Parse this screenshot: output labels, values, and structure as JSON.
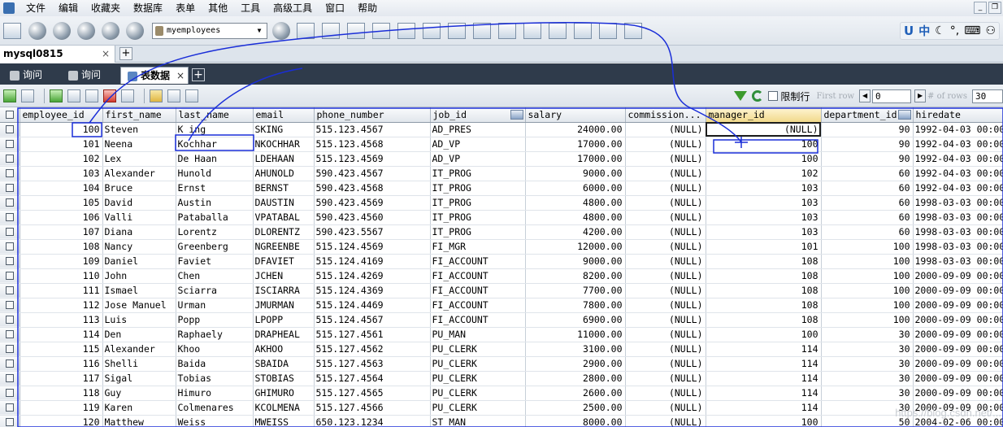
{
  "menu": [
    "文件",
    "编辑",
    "收藏夹",
    "数据库",
    "表单",
    "其他",
    "工具",
    "高级工具",
    "窗口",
    "帮助"
  ],
  "toolbar": {
    "database_select": "myemployees"
  },
  "ime": {
    "logo": "U",
    "lang": "中",
    "punct": "°,"
  },
  "connection_tab": {
    "label": "mysql0815",
    "close": "×",
    "add": "+"
  },
  "query_tabs": [
    {
      "label": "询问",
      "active": false
    },
    {
      "label": "询问",
      "active": false
    },
    {
      "label": "表数据",
      "active": true,
      "close": "×"
    }
  ],
  "query_add": "+",
  "grid_toolbar": {
    "limit_label": "限制行",
    "first_row_placeholder": "First row",
    "first_row_value": "0",
    "num_rows_placeholder": "# of rows",
    "num_rows_value": "30"
  },
  "columns": [
    "employee_id",
    "first_name",
    "last_name",
    "email",
    "phone_number",
    "job_id",
    "salary",
    "commission...",
    "manager_id",
    "department_id",
    "hiredate"
  ],
  "rows": [
    [
      "100",
      "Steven",
      "K_ing",
      "SKING",
      "515.123.4567",
      "AD_PRES",
      "24000.00",
      "(NULL)",
      "(NULL)",
      "90",
      "1992-04-03 00:00"
    ],
    [
      "101",
      "Neena",
      "Kochhar",
      "NKOCHHAR",
      "515.123.4568",
      "AD_VP",
      "17000.00",
      "(NULL)",
      "100",
      "90",
      "1992-04-03 00:00"
    ],
    [
      "102",
      "Lex",
      "De Haan",
      "LDEHAAN",
      "515.123.4569",
      "AD_VP",
      "17000.00",
      "(NULL)",
      "100",
      "90",
      "1992-04-03 00:00"
    ],
    [
      "103",
      "Alexander",
      "Hunold",
      "AHUNOLD",
      "590.423.4567",
      "IT_PROG",
      "9000.00",
      "(NULL)",
      "102",
      "60",
      "1992-04-03 00:00"
    ],
    [
      "104",
      "Bruce",
      "Ernst",
      "BERNST",
      "590.423.4568",
      "IT_PROG",
      "6000.00",
      "(NULL)",
      "103",
      "60",
      "1992-04-03 00:00"
    ],
    [
      "105",
      "David",
      "Austin",
      "DAUSTIN",
      "590.423.4569",
      "IT_PROG",
      "4800.00",
      "(NULL)",
      "103",
      "60",
      "1998-03-03 00:00"
    ],
    [
      "106",
      "Valli",
      "Pataballa",
      "VPATABAL",
      "590.423.4560",
      "IT_PROG",
      "4800.00",
      "(NULL)",
      "103",
      "60",
      "1998-03-03 00:00"
    ],
    [
      "107",
      "Diana",
      "Lorentz",
      "DLORENTZ",
      "590.423.5567",
      "IT_PROG",
      "4200.00",
      "(NULL)",
      "103",
      "60",
      "1998-03-03 00:00"
    ],
    [
      "108",
      "Nancy",
      "Greenberg",
      "NGREENBE",
      "515.124.4569",
      "FI_MGR",
      "12000.00",
      "(NULL)",
      "101",
      "100",
      "1998-03-03 00:00"
    ],
    [
      "109",
      "Daniel",
      "Faviet",
      "DFAVIET",
      "515.124.4169",
      "FI_ACCOUNT",
      "9000.00",
      "(NULL)",
      "108",
      "100",
      "1998-03-03 00:00"
    ],
    [
      "110",
      "John",
      "Chen",
      "JCHEN",
      "515.124.4269",
      "FI_ACCOUNT",
      "8200.00",
      "(NULL)",
      "108",
      "100",
      "2000-09-09 00:00"
    ],
    [
      "111",
      "Ismael",
      "Sciarra",
      "ISCIARRA",
      "515.124.4369",
      "FI_ACCOUNT",
      "7700.00",
      "(NULL)",
      "108",
      "100",
      "2000-09-09 00:00"
    ],
    [
      "112",
      "Jose Manuel",
      "Urman",
      "JMURMAN",
      "515.124.4469",
      "FI_ACCOUNT",
      "7800.00",
      "(NULL)",
      "108",
      "100",
      "2000-09-09 00:00"
    ],
    [
      "113",
      "Luis",
      "Popp",
      "LPOPP",
      "515.124.4567",
      "FI_ACCOUNT",
      "6900.00",
      "(NULL)",
      "108",
      "100",
      "2000-09-09 00:00"
    ],
    [
      "114",
      "Den",
      "Raphaely",
      "DRAPHEAL",
      "515.127.4561",
      "PU_MAN",
      "11000.00",
      "(NULL)",
      "100",
      "30",
      "2000-09-09 00:00"
    ],
    [
      "115",
      "Alexander",
      "Khoo",
      "AKHOO",
      "515.127.4562",
      "PU_CLERK",
      "3100.00",
      "(NULL)",
      "114",
      "30",
      "2000-09-09 00:00"
    ],
    [
      "116",
      "Shelli",
      "Baida",
      "SBAIDA",
      "515.127.4563",
      "PU_CLERK",
      "2900.00",
      "(NULL)",
      "114",
      "30",
      "2000-09-09 00:00"
    ],
    [
      "117",
      "Sigal",
      "Tobias",
      "STOBIAS",
      "515.127.4564",
      "PU_CLERK",
      "2800.00",
      "(NULL)",
      "114",
      "30",
      "2000-09-09 00:00"
    ],
    [
      "118",
      "Guy",
      "Himuro",
      "GHIMURO",
      "515.127.4565",
      "PU_CLERK",
      "2600.00",
      "(NULL)",
      "114",
      "30",
      "2000-09-09 00:00"
    ],
    [
      "119",
      "Karen",
      "Colmenares",
      "KCOLMENA",
      "515.127.4566",
      "PU_CLERK",
      "2500.00",
      "(NULL)",
      "114",
      "30",
      "2000-09-09 00:00"
    ],
    [
      "120",
      "Matthew",
      "Weiss",
      "MWEISS",
      "650.123.1234",
      "ST_MAN",
      "8000.00",
      "(NULL)",
      "100",
      "50",
      "2004-02-06 00:00"
    ]
  ],
  "watermark": "https://blog.csdn.net/...",
  "colors": {
    "annotation": "#1a2ed8",
    "tab_strip": "#2f3b4b",
    "sorted_header": "#f1d98b"
  }
}
